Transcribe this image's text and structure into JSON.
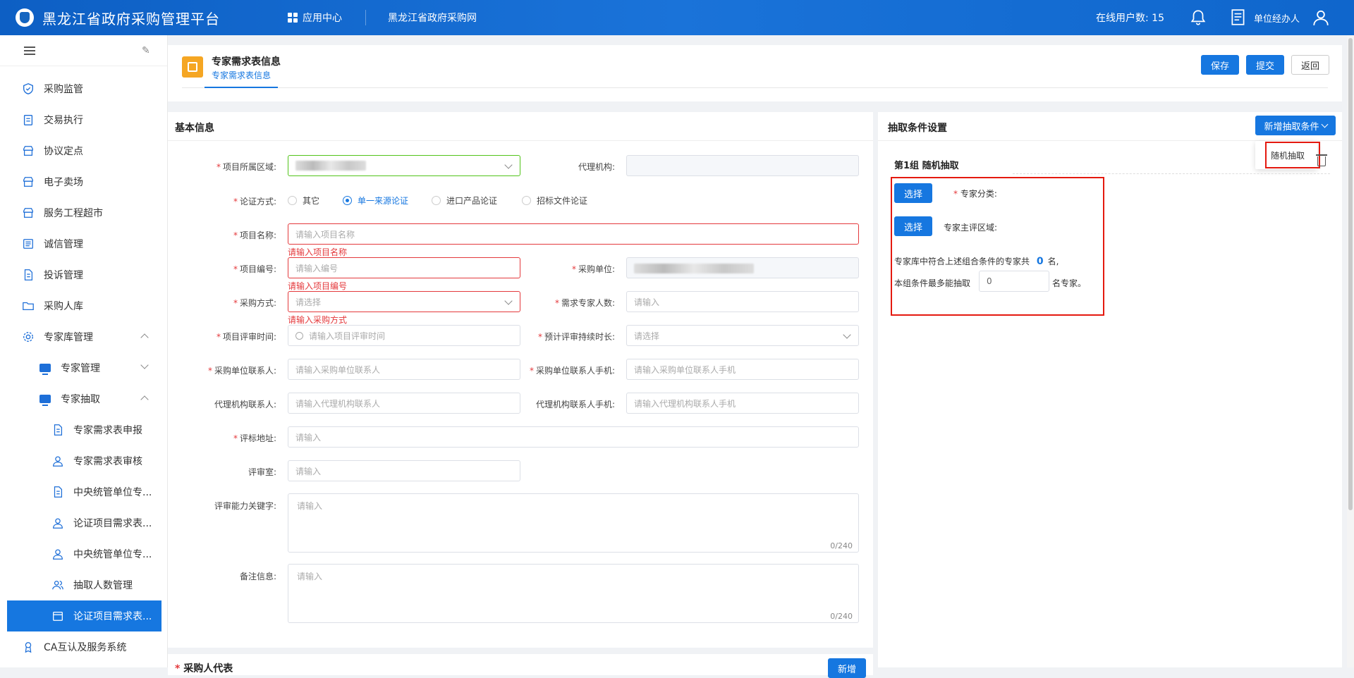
{
  "app": {
    "title": "黑龙江省政府采购管理平台"
  },
  "nav": {
    "app_center": "应用中心",
    "site": "黑龙江省政府采购网",
    "online_label": "在线用户数: 15",
    "user": "单位经办人"
  },
  "sidebar": {
    "items": [
      {
        "label": "采购监管",
        "icon": "shield-icon"
      },
      {
        "label": "交易执行",
        "icon": "clipboard-icon"
      },
      {
        "label": "协议定点",
        "icon": "store-icon"
      },
      {
        "label": "电子卖场",
        "icon": "store-icon"
      },
      {
        "label": "服务工程超市",
        "icon": "store-icon"
      },
      {
        "label": "诚信管理",
        "icon": "list-icon"
      },
      {
        "label": "投诉管理",
        "icon": "document-icon"
      },
      {
        "label": "采购人库",
        "icon": "folder-icon"
      },
      {
        "label": "专家库管理",
        "icon": "gear-icon"
      },
      {
        "label": "专家管理",
        "icon": "monitor-icon"
      },
      {
        "label": "专家抽取",
        "icon": "monitor-icon"
      },
      {
        "label": "专家需求表申报",
        "icon": "document-icon"
      },
      {
        "label": "专家需求表审核",
        "icon": "user-icon"
      },
      {
        "label": "中央统管单位专...",
        "icon": "document-icon"
      },
      {
        "label": "论证项目需求表...",
        "icon": "user-icon"
      },
      {
        "label": "中央统管单位专...",
        "icon": "user-icon"
      },
      {
        "label": "抽取人数管理",
        "icon": "users-icon"
      },
      {
        "label": "论证项目需求表...",
        "icon": "calendar-icon"
      },
      {
        "label": "CA互认及服务系统",
        "icon": "badge-icon"
      }
    ]
  },
  "header": {
    "title": "专家需求表信息",
    "tab": "专家需求表信息",
    "save": "保存",
    "submit": "提交",
    "back": "返回"
  },
  "basic": {
    "title": "基本信息",
    "labels": {
      "region": "项目所属区域:",
      "agency": "代理机构:",
      "method": "论证方式:",
      "name": "项目名称:",
      "code": "项目编号:",
      "unit": "采购单位:",
      "purchase_way": "采购方式:",
      "expert_num": "需求专家人数:",
      "review_time": "项目评审时间:",
      "duration": "预计评审持续时长:",
      "contact": "采购单位联系人:",
      "contact_phone": "采购单位联系人手机:",
      "agent_contact": "代理机构联系人:",
      "agent_phone": "代理机构联系人手机:",
      "address": "评标地址:",
      "room": "评审室:",
      "keywords": "评审能力关键字:",
      "remark": "备注信息:"
    },
    "radios": [
      "其它",
      "单一来源论证",
      "进口产品论证",
      "招标文件论证"
    ],
    "placeholders": {
      "name": "请输入项目名称",
      "code": "请输入编号",
      "purchase_way": "请选择",
      "expert_num": "请输入",
      "review_time": "请输入项目评审时间",
      "duration": "请选择",
      "contact": "请输入采购单位联系人",
      "contact_phone": "请输入采购单位联系人手机",
      "agent_contact": "请输入代理机构联系人",
      "agent_phone": "请输入代理机构联系人手机",
      "address": "请输入",
      "room": "请输入",
      "keywords": "请输入",
      "remark": "请输入"
    },
    "errors": {
      "name": "请输入项目名称",
      "code": "请输入项目编号",
      "purchase_way": "请输入采购方式"
    },
    "counter": "0/240"
  },
  "extract": {
    "title": "抽取条件设置",
    "add_button": "新增抽取条件",
    "dropdown_item": "随机抽取",
    "group_title": "第1组   随机抽取",
    "select": "选择",
    "category": "专家分类:",
    "region": "专家主评区域:",
    "count_text_1": "专家库中符合上述组合条件的专家共",
    "count_value": "0",
    "count_text_2": "名,",
    "max_text": "本组条件最多能抽取",
    "max_value": "0",
    "max_suffix": "名专家。"
  },
  "bottom": {
    "title": "采购人代表",
    "add": "新增"
  },
  "colors": {
    "primary": "#1677e0",
    "error": "#e4393c",
    "highlight": "#e4190f"
  }
}
